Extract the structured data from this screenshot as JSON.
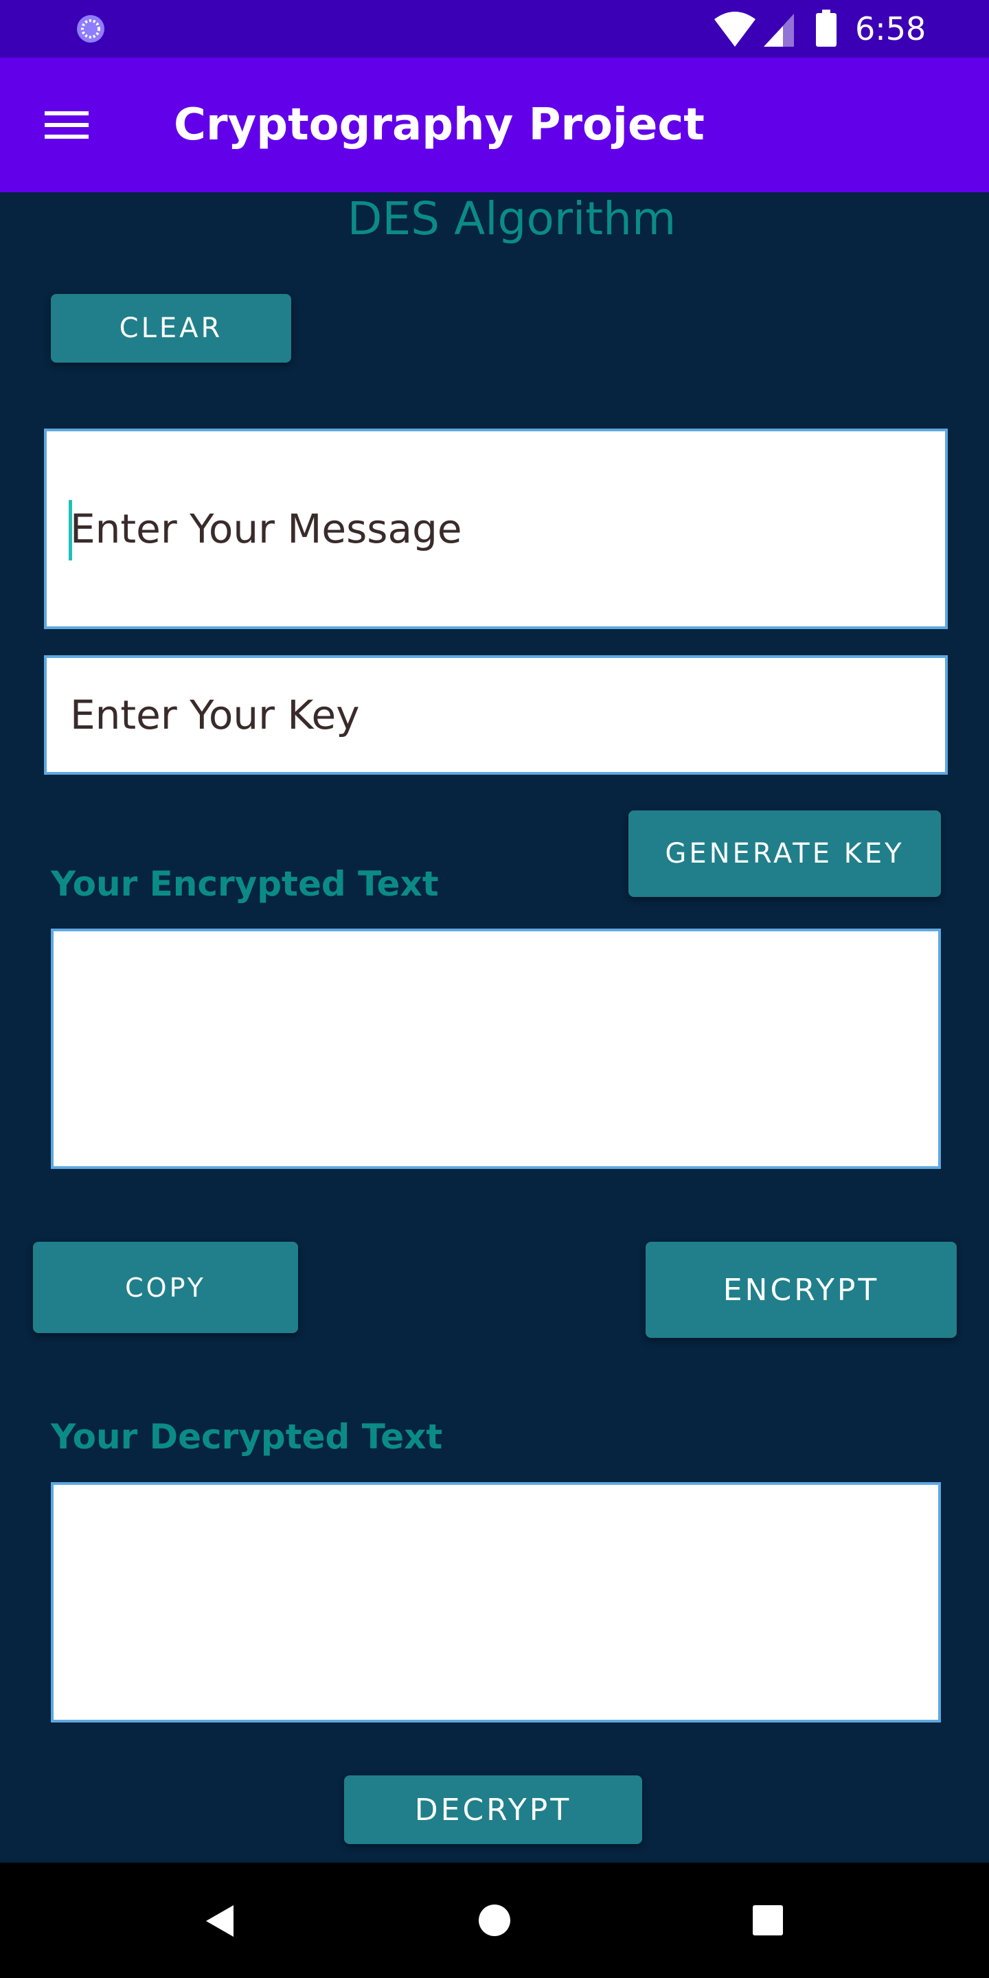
{
  "status_bar": {
    "time": "6:58",
    "icons": [
      "app-notification-icon",
      "wifi-icon",
      "cell-signal-icon",
      "battery-icon"
    ]
  },
  "app_bar": {
    "title": "Cryptography Project",
    "menu_icon": "menu-icon"
  },
  "main": {
    "section_title": "DES Algorithm",
    "clear_label": "CLEAR",
    "message_field": {
      "value": "",
      "placeholder": "Enter Your Message"
    },
    "key_field": {
      "value": "",
      "placeholder": "Enter Your Key"
    },
    "generate_key_label": "GENERATE KEY",
    "encrypted_label": "Your Encrypted Text",
    "encrypted_value": "",
    "copy_label": "COPY",
    "encrypt_label": "ENCRYPT",
    "decrypted_label": "Your Decrypted Text",
    "decrypted_value": "",
    "decrypt_label": "DECRYPT"
  },
  "nav_bar": {
    "icons": [
      "back-icon",
      "home-icon",
      "recent-apps-icon"
    ]
  },
  "colors": {
    "status_bar": "#3b00b5",
    "app_bar": "#6200ea",
    "background": "#06233f",
    "accent_text": "#0b8b87",
    "button": "#207f8a",
    "field_border": "#5ea8e0"
  }
}
